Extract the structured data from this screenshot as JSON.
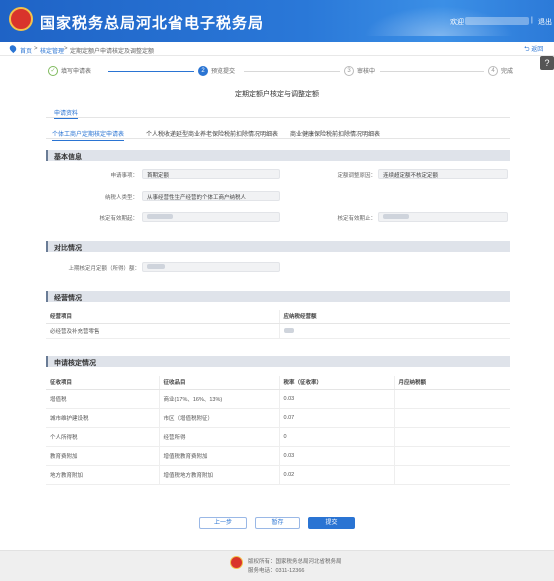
{
  "header": {
    "title": "国家税务总局河北省电子税务局",
    "welcome": "欢迎",
    "separator": "|",
    "logout": "退出",
    "brand_color": "#2a74d3"
  },
  "breadcrumb": {
    "home": "首页",
    "sep": ">",
    "level2": "核定管理",
    "level3": "定期定额户申请核定及调整定额"
  },
  "back_label": "返回",
  "help_icon": "?",
  "steps": [
    {
      "num": "1",
      "label": "填写申请表",
      "state": "done"
    },
    {
      "num": "2",
      "label": "预览提交",
      "state": "active"
    },
    {
      "num": "3",
      "label": "审核中",
      "state": "todo"
    },
    {
      "num": "4",
      "label": "完成",
      "state": "todo"
    }
  ],
  "form_title": "定期定额户核定与调整定额",
  "tab_top": "申请资料",
  "tabs": [
    "个体工商户定期核定申请表",
    "个人税收递延型商业养老保险税前扣除情况明细表",
    "商业健康保险税前扣除情况明细表"
  ],
  "basic": {
    "heading": "基本信息",
    "apply_type_label": "申请事项：",
    "apply_type_value": "首期定额",
    "adjust_reason_label": "定额调整原因：",
    "adjust_reason_value": "连续超定额不核定定额",
    "taxpayer_type_label": "纳税人类型：",
    "taxpayer_type_value": "从事经营性生产经营的个体工商户纳税人",
    "start_label": "核定有效期起：",
    "end_label": "核定有效期止："
  },
  "compare": {
    "heading": "对比情况",
    "last_income_label": "上期核定月定额（所得）额："
  },
  "operation": {
    "heading": "经营情况",
    "columns": [
      "经营项目",
      "应纳税经营额"
    ],
    "rows": [
      [
        "必经营及补充营零售",
        ""
      ]
    ]
  },
  "apply": {
    "heading": "申请核定情况",
    "columns": [
      "征收项目",
      "征收品目",
      "税率（征收率）",
      "月应纳税额"
    ],
    "rows": [
      [
        "增值税",
        "商业(17%、16%、13%)",
        "0.03",
        ""
      ],
      [
        "城市维护建设税",
        "市区（增值税附征）",
        "0.07",
        ""
      ],
      [
        "个人所得税",
        "经营所得",
        "0",
        ""
      ],
      [
        "教育费附加",
        "增值税教育费附加",
        "0.03",
        ""
      ],
      [
        "地方教育附加",
        "增值税地方教育附加",
        "0.02",
        ""
      ]
    ]
  },
  "buttons": {
    "prev": "上一步",
    "save": "暂存",
    "submit": "提交"
  },
  "footer": {
    "line1": "版权所有：国家税务总局河北省税务局",
    "line2": "服务电话：0311-12366"
  }
}
